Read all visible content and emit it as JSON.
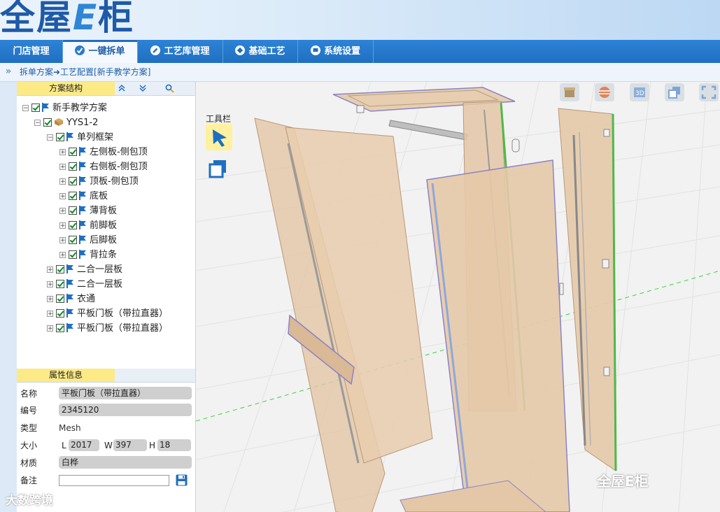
{
  "app": {
    "logo": "全屋E柜",
    "logo_main": "全屋",
    "logo_e": "E",
    "logo_end": "柜"
  },
  "nav": {
    "tabs": [
      {
        "label": "门店管理",
        "icon": "none",
        "active": false
      },
      {
        "label": "一键拆单",
        "icon": "check-circle-icon",
        "active": true
      },
      {
        "label": "工艺库管理",
        "icon": "pencil-circle-icon",
        "active": false
      },
      {
        "label": "基础工艺",
        "icon": "tag-circle-icon",
        "active": false
      },
      {
        "label": "系统设置",
        "icon": "monitor-circle-icon",
        "active": false
      }
    ]
  },
  "breadcrumb": {
    "expand_icon": "»",
    "path": "拆单方案➜工艺配置[新手教学方案]"
  },
  "structure_panel": {
    "title": "方案结构"
  },
  "tree": {
    "root": "新手教学方案",
    "cabinet": "YYS1-2",
    "frame": "单列框架",
    "frame_children": [
      "左侧板-侧包顶",
      "右侧板-侧包顶",
      "顶板-侧包顶",
      "底板",
      "薄背板",
      "前脚板",
      "后脚板",
      "背拉条"
    ],
    "other_items": [
      "二合一层板",
      "二合一层板",
      "衣通",
      "平板门板（带拉直器）",
      "平板门板（带拉直器）"
    ]
  },
  "properties": {
    "title": "属性信息",
    "name_label": "名称",
    "name_value": "平板门板（带拉直器）",
    "code_label": "编号",
    "code_value": "2345120",
    "type_label": "类型",
    "type_value": "Mesh",
    "size_label": "大小",
    "l_label": "L",
    "l_value": "2017",
    "w_label": "W",
    "w_value": "397",
    "h_label": "H",
    "h_value": "18",
    "material_label": "材质",
    "material_value": "白桦",
    "note_label": "备注",
    "note_value": ""
  },
  "viewport": {
    "toolbar_label": "工具栏"
  },
  "watermarks": {
    "bottom_right": "全屋E柜",
    "bottom_left": "大数跨境"
  },
  "colors": {
    "nav_blue": "#1f6fc1",
    "panel_title_yellow": "#fcea86",
    "wood": "#e6c9a8",
    "edge_green": "#4fb848",
    "edge_purple": "#8b82c4"
  }
}
